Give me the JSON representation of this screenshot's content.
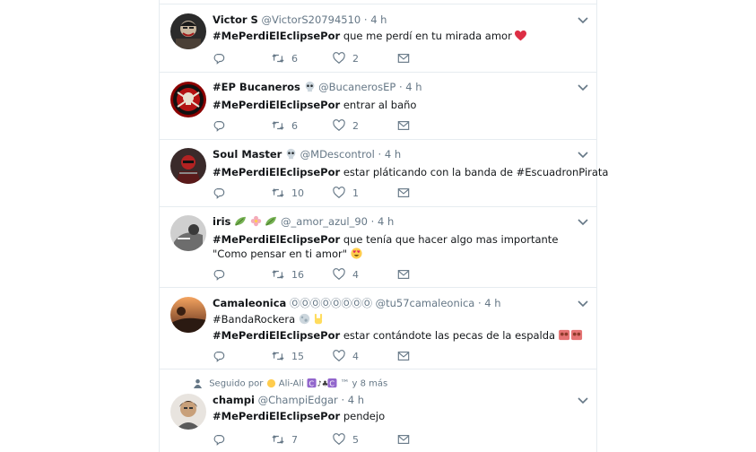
{
  "colors": {
    "text": "#14171a",
    "muted": "#657786",
    "border": "#e6ecf0",
    "heart": "#e0245e"
  },
  "tweets": [
    {
      "name": "Victor S",
      "handle": "@VictorS20794510",
      "dot": "·",
      "time": "4 h",
      "hashtag": "#MePerdiElEclipsePor",
      "text": " que me perdí en tu mirada amor",
      "extra_line": "",
      "replies": "",
      "retweets": "6",
      "likes": "2"
    },
    {
      "name": "#EP Bucaneros",
      "handle": "@BucanerosEP",
      "dot": "·",
      "time": "4 h",
      "hashtag": "#MePerdiElEclipsePor",
      "text": " entrar al baño",
      "extra_line": "",
      "replies": "",
      "retweets": "6",
      "likes": "2"
    },
    {
      "name": "Soul Master",
      "handle": "@MDescontrol",
      "dot": "·",
      "time": "4 h",
      "hashtag": "#MePerdiElEclipsePor",
      "text": " estar pláticando con la banda de #EscuadronPirata",
      "extra_line": "",
      "replies": "",
      "retweets": "10",
      "likes": "1"
    },
    {
      "name": "iris",
      "handle": "@_amor_azul_90",
      "dot": "·",
      "time": "4 h",
      "hashtag": "#MePerdiElEclipsePor",
      "text": " que tenía que hacer algo mas importante",
      "extra_line": "\"Como pensar en ti amor\"",
      "replies": "",
      "retweets": "16",
      "likes": "4"
    },
    {
      "name": "Camaleonica",
      "name_suffix": "ⓄⓄⓄⓄⓄⓄⓄⓄ",
      "handle": "@tu57camaleonica",
      "dot": "·",
      "time": "4 h",
      "pre_line": "#BandaRockera",
      "hashtag": "#MePerdiElEclipsePor",
      "text": " estar contándote las pecas de la espalda",
      "extra_line": "",
      "replies": "",
      "retweets": "15",
      "likes": "4"
    },
    {
      "social_context": "Seguido por",
      "social_names": "Ali-Ali",
      "social_tail": "™ y 8 más",
      "name": "champi",
      "handle": "@ChampiEdgar",
      "dot": "·",
      "time": "4 h",
      "hashtag": "#MePerdiElEclipsePor",
      "text": " pendejo",
      "extra_line": "",
      "replies": "",
      "retweets": "7",
      "likes": "5"
    }
  ],
  "icons": [
    "reply-icon",
    "retweet-icon",
    "heart-icon",
    "message-icon",
    "caret-down-icon",
    "person-icon"
  ]
}
